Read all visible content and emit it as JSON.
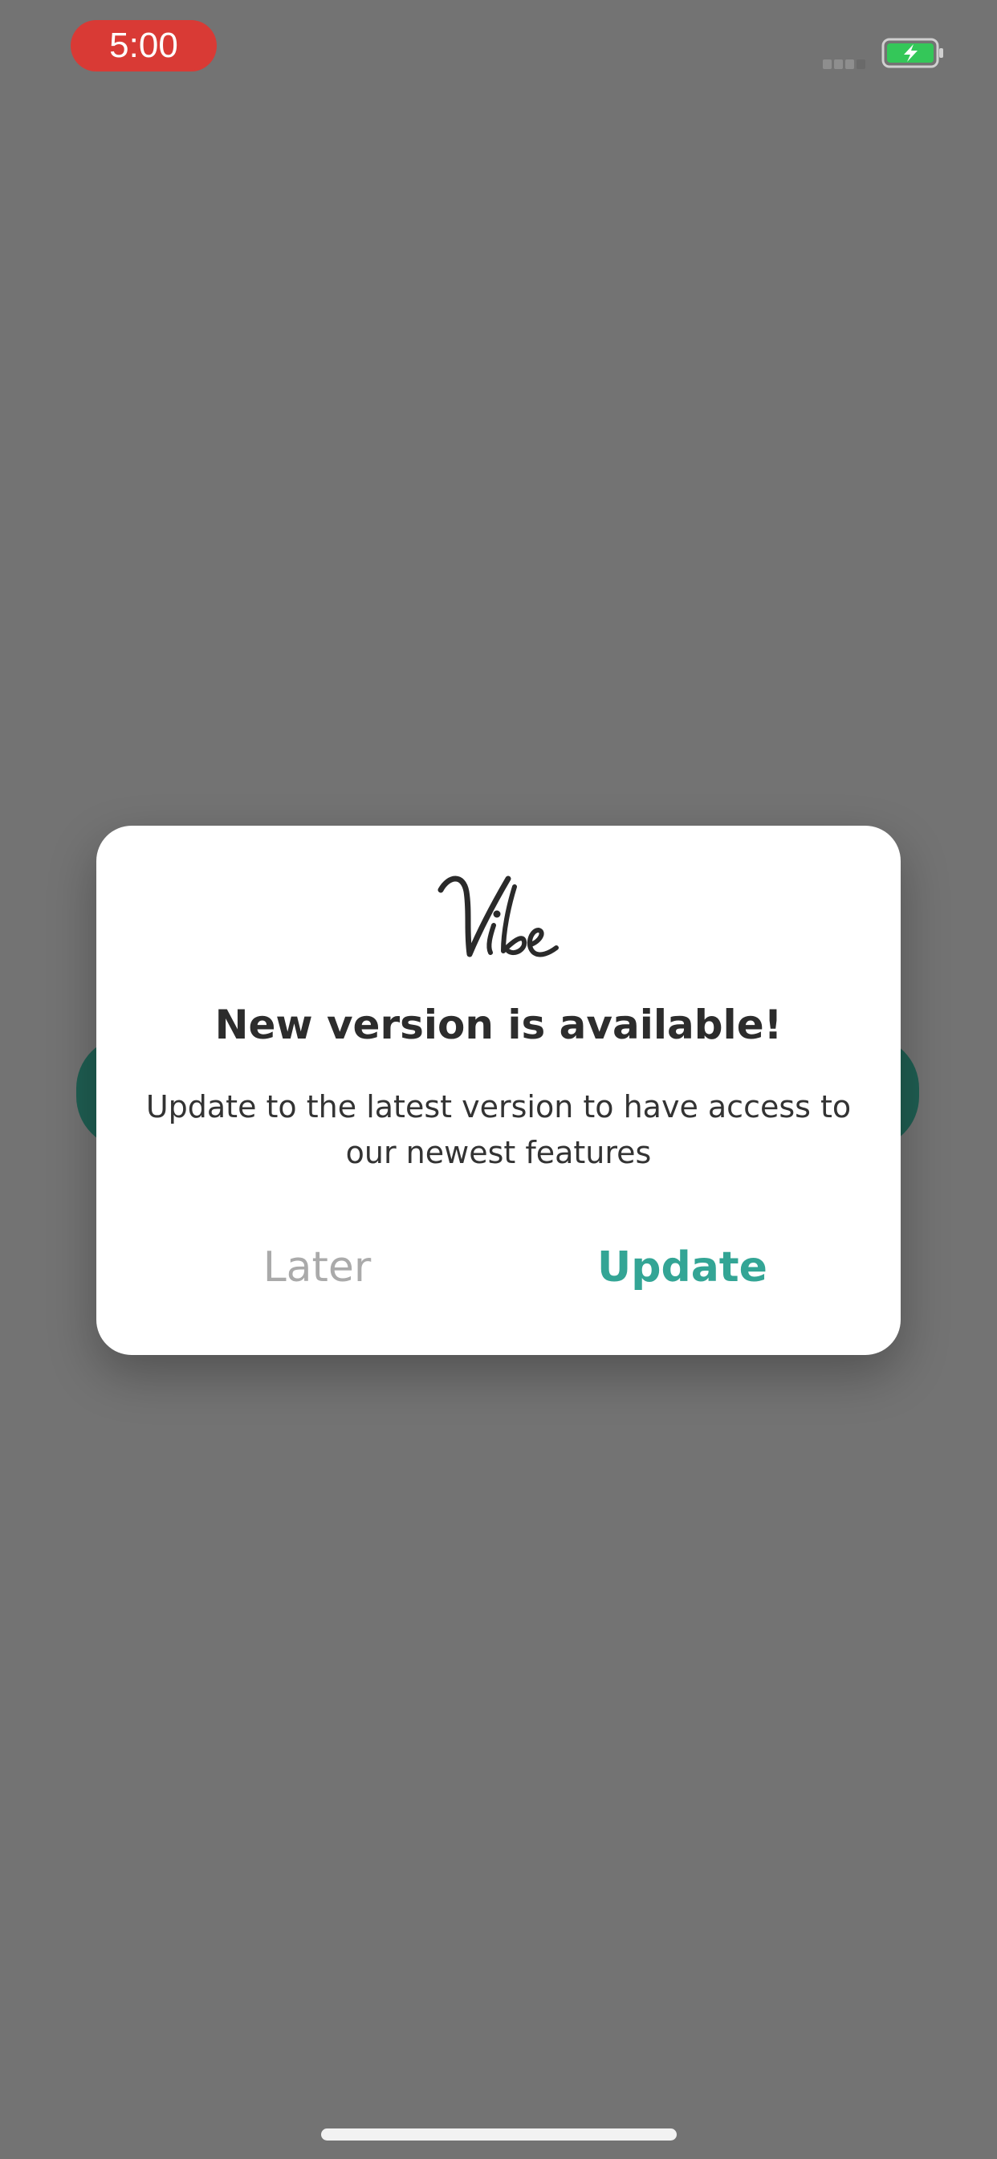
{
  "status_bar": {
    "time": "5:00",
    "time_badge_color": "#d93a35",
    "battery_state": "charging",
    "battery_color": "#34c759"
  },
  "dialog": {
    "logo_text": "Vibe",
    "title": "New version is available!",
    "message": "Update to the latest version to have access to our newest features",
    "later_label": "Later",
    "update_label": "Update",
    "accent_color": "#33a595"
  }
}
